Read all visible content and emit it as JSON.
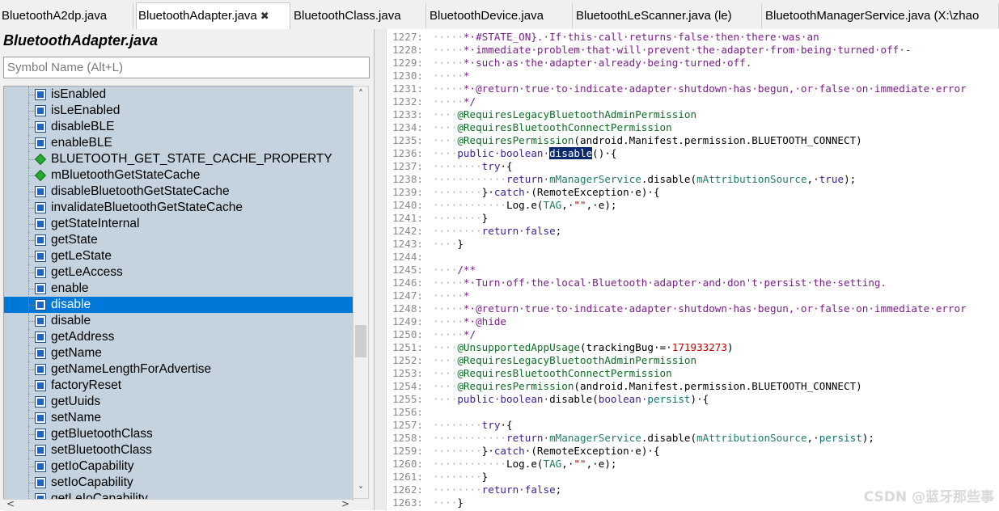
{
  "tabs": [
    {
      "label": "BluetoothA2dp.java",
      "active": false
    },
    {
      "label": "BluetoothAdapter.java",
      "active": true,
      "close": "✖"
    },
    {
      "label": "BluetoothClass.java",
      "active": false
    },
    {
      "label": "BluetoothDevice.java",
      "active": false
    },
    {
      "label": "BluetoothLeScanner.java (le)",
      "active": false
    },
    {
      "label": "BluetoothManagerService.java (X:\\zhao",
      "active": false
    }
  ],
  "symbol_panel": {
    "title": "BluetoothAdapter.java",
    "search_placeholder": "Symbol Name (Alt+L)",
    "items": [
      {
        "label": "isEnabled",
        "kind": "method"
      },
      {
        "label": "isLeEnabled",
        "kind": "method"
      },
      {
        "label": "disableBLE",
        "kind": "method"
      },
      {
        "label": "enableBLE",
        "kind": "method"
      },
      {
        "label": "BLUETOOTH_GET_STATE_CACHE_PROPERTY",
        "kind": "field"
      },
      {
        "label": "mBluetoothGetStateCache",
        "kind": "field"
      },
      {
        "label": "disableBluetoothGetStateCache",
        "kind": "method"
      },
      {
        "label": "invalidateBluetoothGetStateCache",
        "kind": "method"
      },
      {
        "label": "getStateInternal",
        "kind": "method"
      },
      {
        "label": "getState",
        "kind": "method"
      },
      {
        "label": "getLeState",
        "kind": "method"
      },
      {
        "label": "getLeAccess",
        "kind": "method"
      },
      {
        "label": "enable",
        "kind": "method"
      },
      {
        "label": "disable",
        "kind": "method",
        "selected": true
      },
      {
        "label": "disable",
        "kind": "method"
      },
      {
        "label": "getAddress",
        "kind": "method"
      },
      {
        "label": "getName",
        "kind": "method"
      },
      {
        "label": "getNameLengthForAdvertise",
        "kind": "method"
      },
      {
        "label": "factoryReset",
        "kind": "method"
      },
      {
        "label": "getUuids",
        "kind": "method"
      },
      {
        "label": "setName",
        "kind": "method"
      },
      {
        "label": "getBluetoothClass",
        "kind": "method"
      },
      {
        "label": "setBluetoothClass",
        "kind": "method"
      },
      {
        "label": "getIoCapability",
        "kind": "method"
      },
      {
        "label": "setIoCapability",
        "kind": "method"
      },
      {
        "label": "getLeIoCapability",
        "kind": "method"
      }
    ]
  },
  "editor": {
    "lines": [
      {
        "n": "1227:",
        "i": "·····",
        "t": [
          [
            "cm",
            "*·#STATE_ON}.·If·this·call·returns·false·then·there·was·an"
          ]
        ]
      },
      {
        "n": "1228:",
        "i": "·····",
        "t": [
          [
            "cm",
            "*·immediate·problem·that·will·prevent·the·adapter·from·being·turned·off·-"
          ]
        ]
      },
      {
        "n": "1229:",
        "i": "·····",
        "t": [
          [
            "cm",
            "*·such·as·the·adapter·already·being·turned·off."
          ]
        ]
      },
      {
        "n": "1230:",
        "i": "·····",
        "t": [
          [
            "cm",
            "*"
          ]
        ]
      },
      {
        "n": "1231:",
        "i": "·····",
        "t": [
          [
            "cm",
            "*·@return·true·to·indicate·adapter·shutdown·has·begun,·or·false·on·immediate·error"
          ]
        ]
      },
      {
        "n": "1232:",
        "i": "·····",
        "t": [
          [
            "cm",
            "*/"
          ]
        ]
      },
      {
        "n": "1233:",
        "i": "····",
        "t": [
          [
            "an",
            "@RequiresLegacyBluetoothAdminPermission"
          ]
        ]
      },
      {
        "n": "1234:",
        "i": "····",
        "t": [
          [
            "an",
            "@RequiresBluetoothConnectPermission"
          ]
        ]
      },
      {
        "n": "1235:",
        "i": "····",
        "t": [
          [
            "an",
            "@RequiresPermission"
          ],
          [
            "",
            "(android.Manifest.permission.BLUETOOTH_CONNECT)"
          ]
        ]
      },
      {
        "n": "1236:",
        "i": "····",
        "t": [
          [
            "kw",
            "public·boolean·"
          ],
          [
            "hl",
            "disable"
          ],
          [
            "",
            "()·{"
          ]
        ]
      },
      {
        "n": "1237:",
        "i": "········",
        "t": [
          [
            "kw",
            "try"
          ],
          [
            "",
            "·{"
          ]
        ]
      },
      {
        "n": "1238:",
        "i": "············",
        "t": [
          [
            "kw",
            "return·"
          ],
          [
            "fn",
            "mManagerService"
          ],
          [
            "",
            ".disable("
          ],
          [
            "fn",
            "mAttributionSource"
          ],
          [
            "",
            ",·"
          ],
          [
            "kw",
            "true"
          ],
          [
            "",
            ");"
          ]
        ]
      },
      {
        "n": "1239:",
        "i": "········",
        "t": [
          [
            "",
            "}·"
          ],
          [
            "kw",
            "catch"
          ],
          [
            "",
            "·(RemoteException·e)·{"
          ]
        ]
      },
      {
        "n": "1240:",
        "i": "············",
        "t": [
          [
            "",
            "Log.e("
          ],
          [
            "fn",
            "TAG"
          ],
          [
            "",
            ",·"
          ],
          [
            "str",
            "\"\""
          ],
          [
            "",
            ",·e);"
          ]
        ]
      },
      {
        "n": "1241:",
        "i": "········",
        "t": [
          [
            "",
            "}"
          ]
        ]
      },
      {
        "n": "1242:",
        "i": "········",
        "t": [
          [
            "kw",
            "return·false"
          ],
          [
            "",
            ";"
          ]
        ]
      },
      {
        "n": "1243:",
        "i": "····",
        "t": [
          [
            "",
            "}"
          ]
        ]
      },
      {
        "n": "1244:",
        "i": "",
        "t": []
      },
      {
        "n": "1245:",
        "i": "····",
        "t": [
          [
            "cm",
            "/**"
          ]
        ]
      },
      {
        "n": "1246:",
        "i": "·····",
        "t": [
          [
            "cm",
            "*·Turn·off·the·local·Bluetooth·adapter·and·don't·persist·the·setting."
          ]
        ]
      },
      {
        "n": "1247:",
        "i": "·····",
        "t": [
          [
            "cm",
            "*"
          ]
        ]
      },
      {
        "n": "1248:",
        "i": "·····",
        "t": [
          [
            "cm",
            "*·@return·true·to·indicate·adapter·shutdown·has·begun,·or·false·on·immediate·error"
          ]
        ]
      },
      {
        "n": "1249:",
        "i": "·····",
        "t": [
          [
            "cm",
            "*·@hide"
          ]
        ]
      },
      {
        "n": "1250:",
        "i": "·····",
        "t": [
          [
            "cm",
            "*/"
          ]
        ]
      },
      {
        "n": "1251:",
        "i": "····",
        "t": [
          [
            "an",
            "@UnsupportedAppUsage"
          ],
          [
            "",
            "(trackingBug·=·"
          ],
          [
            "nm",
            "171933273"
          ],
          [
            "",
            ")"
          ]
        ]
      },
      {
        "n": "1252:",
        "i": "····",
        "t": [
          [
            "an",
            "@RequiresLegacyBluetoothAdminPermission"
          ]
        ]
      },
      {
        "n": "1253:",
        "i": "····",
        "t": [
          [
            "an",
            "@RequiresBluetoothConnectPermission"
          ]
        ]
      },
      {
        "n": "1254:",
        "i": "····",
        "t": [
          [
            "an",
            "@RequiresPermission"
          ],
          [
            "",
            "(android.Manifest.permission.BLUETOOTH_CONNECT)"
          ]
        ]
      },
      {
        "n": "1255:",
        "i": "····",
        "t": [
          [
            "kw",
            "public·boolean·"
          ],
          [
            "",
            "disable("
          ],
          [
            "kw",
            "boolean·"
          ],
          [
            "pr",
            "persist"
          ],
          [
            "",
            ")·{"
          ]
        ]
      },
      {
        "n": "1256:",
        "i": "",
        "t": []
      },
      {
        "n": "1257:",
        "i": "········",
        "t": [
          [
            "kw",
            "try"
          ],
          [
            "",
            "·{"
          ]
        ]
      },
      {
        "n": "1258:",
        "i": "············",
        "t": [
          [
            "kw",
            "return·"
          ],
          [
            "fn",
            "mManagerService"
          ],
          [
            "",
            ".disable("
          ],
          [
            "fn",
            "mAttributionSource"
          ],
          [
            "",
            ",·"
          ],
          [
            "pr",
            "persist"
          ],
          [
            "",
            ");"
          ]
        ]
      },
      {
        "n": "1259:",
        "i": "········",
        "t": [
          [
            "",
            "}·"
          ],
          [
            "kw",
            "catch"
          ],
          [
            "",
            "·(RemoteException·e)·{"
          ]
        ]
      },
      {
        "n": "1260:",
        "i": "············",
        "t": [
          [
            "",
            "Log.e("
          ],
          [
            "fn",
            "TAG"
          ],
          [
            "",
            ",·"
          ],
          [
            "str",
            "\"\""
          ],
          [
            "",
            ",·e);"
          ]
        ]
      },
      {
        "n": "1261:",
        "i": "········",
        "t": [
          [
            "",
            "}"
          ]
        ]
      },
      {
        "n": "1262:",
        "i": "········",
        "t": [
          [
            "kw",
            "return·false"
          ],
          [
            "",
            ";"
          ]
        ]
      },
      {
        "n": "1263:",
        "i": "····",
        "t": [
          [
            "",
            "}"
          ]
        ]
      }
    ]
  },
  "watermark": "CSDN @蓝牙那些事"
}
